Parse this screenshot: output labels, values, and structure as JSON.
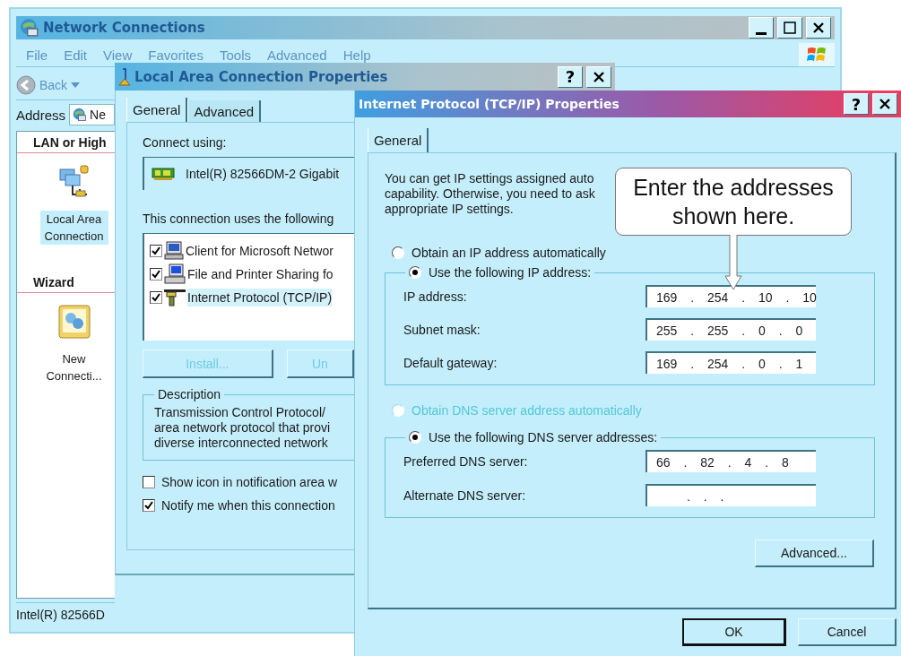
{
  "network_window": {
    "title": "Network Connections",
    "menu": [
      "File",
      "Edit",
      "View",
      "Favorites",
      "Tools",
      "Advanced",
      "Help"
    ],
    "back_label": "Back",
    "address": {
      "label": "Address",
      "value": "Ne"
    },
    "sidebar": [
      {
        "heading": "LAN or High",
        "items": [
          {
            "label": "Local Area Connection",
            "kind": "connection",
            "selected": true
          }
        ]
      },
      {
        "heading": "Wizard",
        "items": [
          {
            "label": "New Connecti...",
            "kind": "wizard",
            "selected": false
          }
        ]
      }
    ],
    "status_bar": "Intel(R) 82566D"
  },
  "lan_properties": {
    "title": "Local Area Connection Properties",
    "help_button": "?",
    "tabs": [
      {
        "label": "General",
        "selected": true
      },
      {
        "label": "Advanced",
        "selected": false
      }
    ],
    "connect_using_label": "Connect using:",
    "adapter": "Intel(R) 82566DM-2 Gigabit",
    "components_label": "This connection uses the following",
    "components": [
      {
        "label": "Client for Microsoft Networ",
        "kind": "client",
        "checked": true,
        "selected": false
      },
      {
        "label": "File and Printer Sharing fo",
        "kind": "sharing",
        "checked": true,
        "selected": false
      },
      {
        "label": "Internet Protocol (TCP/IP)",
        "kind": "protocol",
        "checked": true,
        "selected": true
      }
    ],
    "buttons": [
      {
        "label": "Install...",
        "disabled": true
      },
      {
        "label": "Un",
        "disabled": true
      }
    ],
    "description": {
      "title": "Description",
      "lines": [
        "Transmission Control Protocol/",
        "area network protocol that provi",
        "diverse interconnected network"
      ]
    },
    "options": [
      {
        "label": "Show icon in notification area w",
        "checked": false
      },
      {
        "label": "Notify me when this connection",
        "checked": true
      }
    ]
  },
  "tcpip_properties": {
    "title": "Internet Protocol (TCP/IP) Properties",
    "help_button": "?",
    "tabs": [
      {
        "label": "General",
        "selected": true
      }
    ],
    "intro_lines": [
      "You can get IP settings assigned auto",
      "capability. Otherwise, you need to ask",
      "appropriate IP settings."
    ],
    "ip_mode": [
      {
        "label": "Obtain an IP address automatically",
        "selected": false,
        "disabled": false
      },
      {
        "label": "Use the following IP address:",
        "selected": true,
        "disabled": false
      }
    ],
    "ip_fields": [
      {
        "label": "IP address:",
        "value": "169 . 254 . 10 . 10"
      },
      {
        "label": "Subnet mask:",
        "value": "255 . 255 . 0 . 0"
      },
      {
        "label": "Default gateway:",
        "value": "169 . 254 . 0 . 1"
      }
    ],
    "dns_mode": [
      {
        "label": "Obtain DNS server address automatically",
        "selected": false,
        "disabled": true
      },
      {
        "label": "Use the following DNS server addresses:",
        "selected": true,
        "disabled": false
      }
    ],
    "dns_fields": [
      {
        "label": "Preferred DNS server:",
        "value": "66 . 82 . 4 . 8"
      },
      {
        "label": "Alternate DNS server:",
        "value": ". . ."
      }
    ],
    "advanced_button": "Advanced...",
    "buttons": [
      {
        "label": "OK",
        "default": true
      },
      {
        "label": "Cancel",
        "default": false
      }
    ]
  },
  "callout": {
    "lines": [
      "Enter the addresses",
      "shown here."
    ]
  }
}
